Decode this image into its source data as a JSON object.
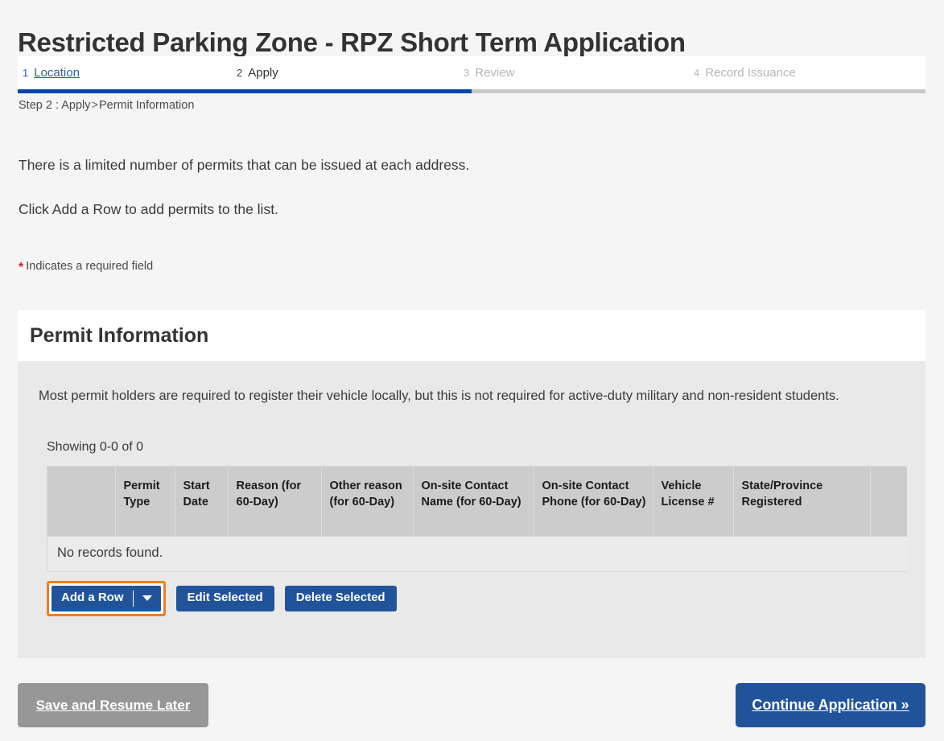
{
  "page": {
    "title": "Restricted Parking Zone - RPZ Short Term Application",
    "breadcrumb_prefix": "Step 2 : Apply",
    "breadcrumb_sep": ">",
    "breadcrumb_current": "Permit Information",
    "intro_line_1": "There is a limited number of permits that can be issued at each address.",
    "intro_line_2": "Click Add a Row to add permits to the list.",
    "required_star": "*",
    "required_note": "Indicates a required field",
    "accent_blue": "#21539b",
    "progress_blue": "#0246a8",
    "highlight_orange": "#f07d1c",
    "required_red": "#d81f26"
  },
  "steps": [
    {
      "num": "1",
      "label": "Location",
      "state": "link"
    },
    {
      "num": "2",
      "label": "Apply",
      "state": "current"
    },
    {
      "num": "3",
      "label": "Review",
      "state": "future"
    },
    {
      "num": "4",
      "label": "Record Issuance",
      "state": "future"
    }
  ],
  "progress": {
    "percent": "50"
  },
  "panel": {
    "heading": "Permit Information",
    "description": "Most permit holders are required to register their vehicle locally, but this is not required for active-duty military and non-resident students.",
    "showing": "Showing 0-0 of 0",
    "empty_message": "No records found."
  },
  "table": {
    "headers": [
      "",
      "Permit Type",
      "Start Date",
      "Reason (for 60-Day)",
      "Other reason (for 60-Day)",
      "On-site Contact Name (for 60-Day)",
      "On-site Contact Phone (for 60-Day)",
      "Vehicle License #",
      "State/Province Registered",
      ""
    ],
    "rows": []
  },
  "row_actions": {
    "add_row": "Add a Row",
    "add_row_caret": "▼",
    "edit_selected": "Edit Selected",
    "delete_selected": "Delete Selected"
  },
  "footer": {
    "save_label": "Save and Resume Later",
    "continue_label": "Continue Application »"
  }
}
